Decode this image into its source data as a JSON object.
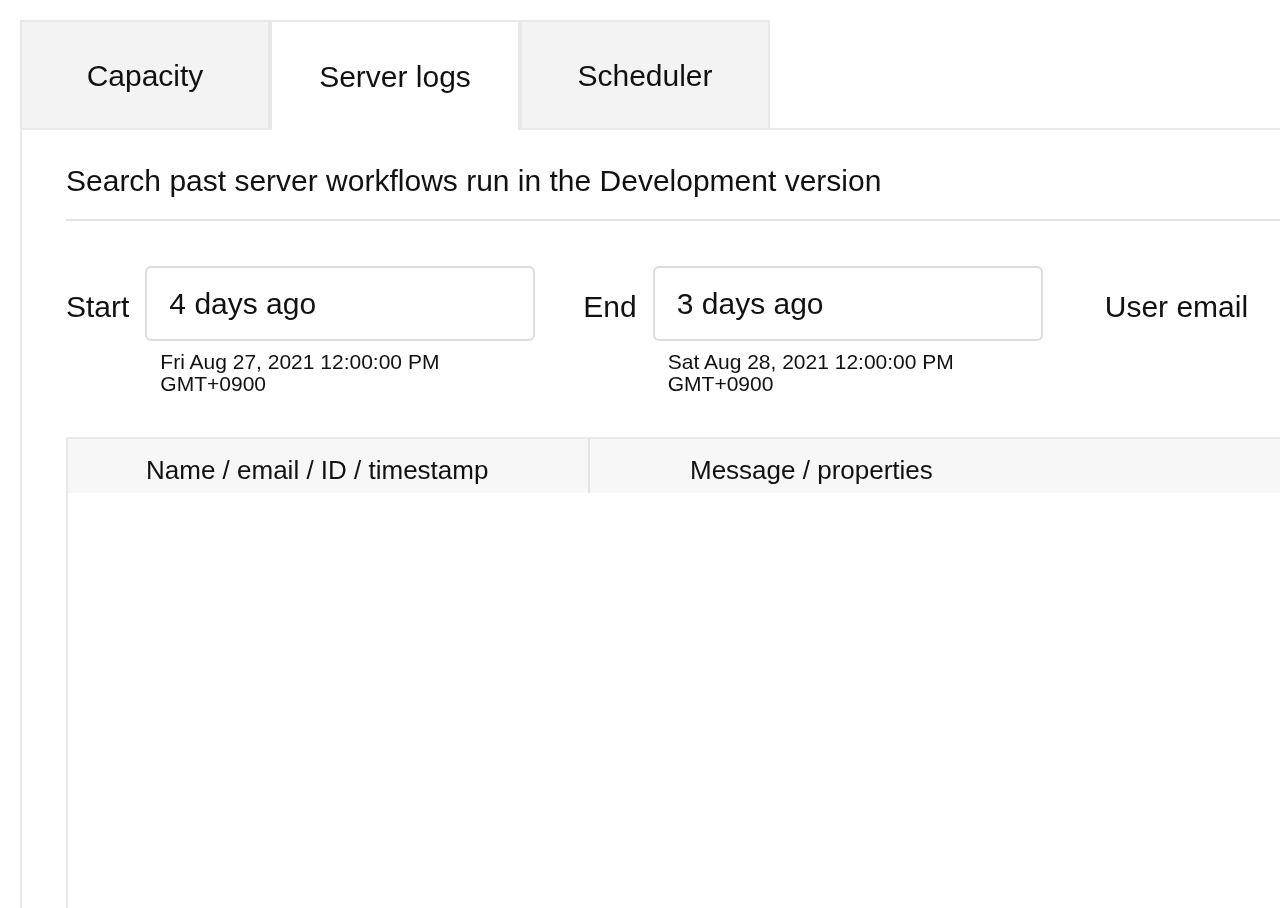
{
  "tabs": [
    {
      "label": "Capacity",
      "selected": false
    },
    {
      "label": "Server logs",
      "selected": true
    },
    {
      "label": "Scheduler",
      "selected": false
    }
  ],
  "heading": "Search past server workflows run in the Development version",
  "filters": [
    {
      "label": "Start",
      "value": "4 days ago",
      "hint": "Fri Aug 27, 2021 12:00:00 PM GMT+0900"
    },
    {
      "label": "End",
      "value": "3 days ago",
      "hint": "Sat Aug 28, 2021 12:00:00 PM GMT+0900"
    }
  ],
  "user_email_label": "User email",
  "table": {
    "columns": [
      "Name / email / ID / timestamp",
      "Message / properties"
    ]
  }
}
